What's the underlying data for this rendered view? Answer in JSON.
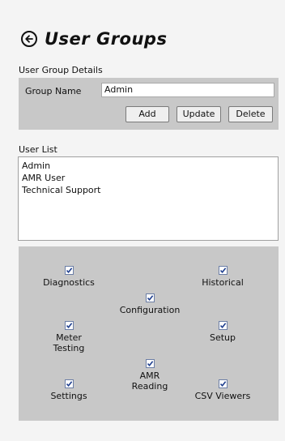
{
  "header": {
    "title": "User Groups",
    "back_icon": "circle-arrow-left-icon"
  },
  "details": {
    "section_label": "User Group Details",
    "group_name_label": "Group Name",
    "group_name_value": "Admin",
    "add_label": "Add",
    "update_label": "Update",
    "delete_label": "Delete"
  },
  "user_list": {
    "label": "User List",
    "items": [
      "Admin",
      "AMR User",
      "Technical Support"
    ]
  },
  "permissions": [
    {
      "label": "Diagnostics",
      "checked": true
    },
    {
      "label": "Historical",
      "checked": true
    },
    {
      "label": "Configuration",
      "checked": true
    },
    {
      "label": "Meter Testing",
      "checked": true
    },
    {
      "label": "Setup",
      "checked": true
    },
    {
      "label": "Settings",
      "checked": true
    },
    {
      "label": "AMR Reading",
      "checked": true
    },
    {
      "label": "CSV Viewers",
      "checked": true
    }
  ],
  "colors": {
    "panel": "#c8c8c8",
    "background": "#f4f4f4",
    "checkmark": "#1f3f8f"
  }
}
